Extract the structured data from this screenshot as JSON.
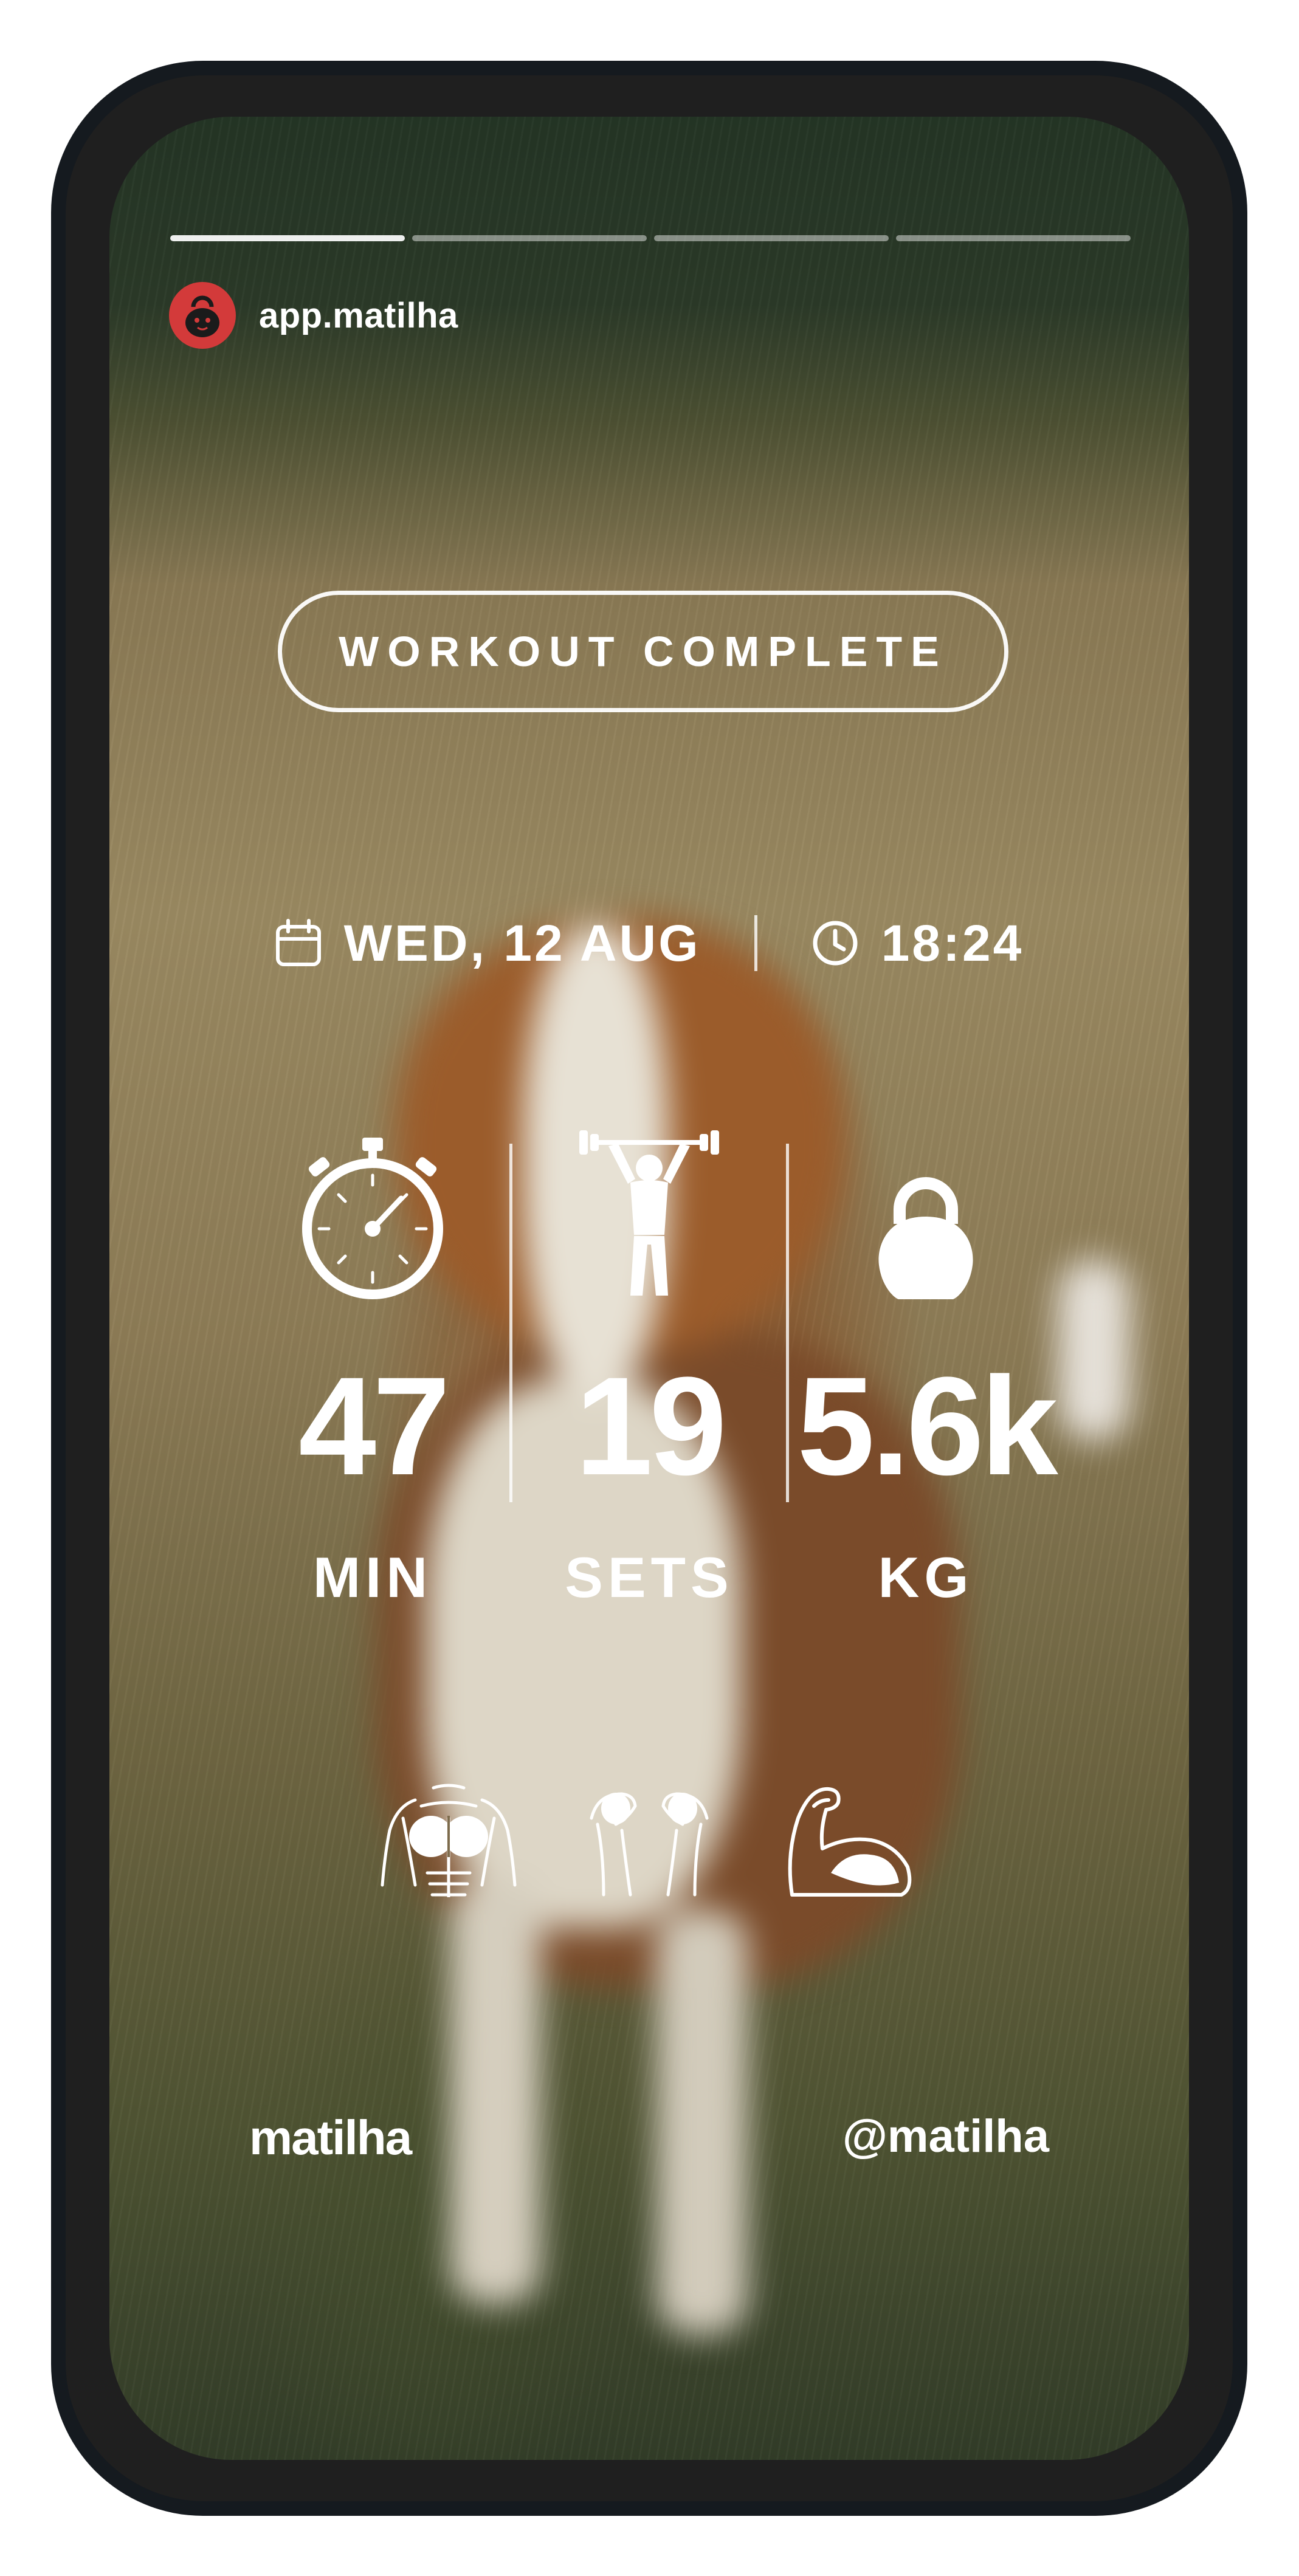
{
  "story": {
    "progress_segments": 4,
    "active_segments": 1,
    "account": {
      "username": "app.matilha",
      "avatar_icon": "kettlebell-icon",
      "avatar_color": "#d33a3a"
    },
    "badge": "WORKOUT COMPLETE",
    "date": {
      "icon": "calendar-icon",
      "label": "WED, 12 AUG"
    },
    "time": {
      "icon": "clock-icon",
      "label": "18:24"
    },
    "stats": [
      {
        "icon": "stopwatch-icon",
        "value": "47",
        "label": "MIN"
      },
      {
        "icon": "weightlifter-icon",
        "value": "19",
        "label": "SETS"
      },
      {
        "icon": "kettlebell-icon",
        "value": "5.6k",
        "label": "KG"
      }
    ],
    "muscle_icons": [
      "chest-icon",
      "shoulders-icon",
      "biceps-icon"
    ],
    "footer": {
      "brand": "matilha",
      "handle": "@matilha"
    }
  }
}
